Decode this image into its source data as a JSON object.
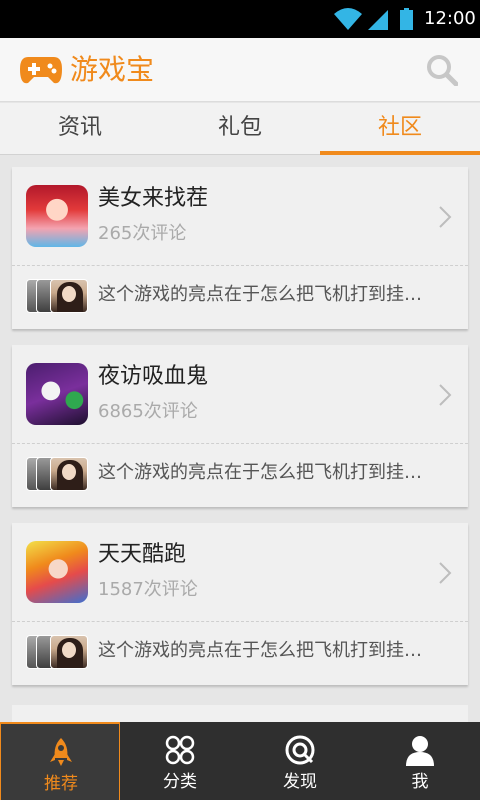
{
  "status_bar": {
    "time": "12:00"
  },
  "app": {
    "title": "游戏宝"
  },
  "top_tabs": [
    {
      "label": "资讯",
      "active": false
    },
    {
      "label": "礼包",
      "active": false
    },
    {
      "label": "社区",
      "active": true
    }
  ],
  "cards": [
    {
      "title": "美女来找茬",
      "comments": "265次评论",
      "preview": "这个游戏的亮点在于怎么把飞机打到挂…",
      "thumb_icon": "game-thumbnail-anime-girl"
    },
    {
      "title": "夜访吸血鬼",
      "comments": "6865次评论",
      "preview": "这个游戏的亮点在于怎么把飞机打到挂…",
      "thumb_icon": "game-thumbnail-vampire"
    },
    {
      "title": "天天酷跑",
      "comments": "1587次评论",
      "preview": "这个游戏的亮点在于怎么把飞机打到挂…",
      "thumb_icon": "game-thumbnail-runner"
    }
  ],
  "bottom_nav": [
    {
      "label": "推荐",
      "icon": "rocket-icon",
      "active": true
    },
    {
      "label": "分类",
      "icon": "grid-icon",
      "active": false
    },
    {
      "label": "发现",
      "icon": "discover-icon",
      "active": false
    },
    {
      "label": "我",
      "icon": "user-icon",
      "active": false
    }
  ],
  "colors": {
    "accent": "#f08a1c",
    "nav_background": "#2f2f2f",
    "header_background": "#f7f7f7"
  }
}
